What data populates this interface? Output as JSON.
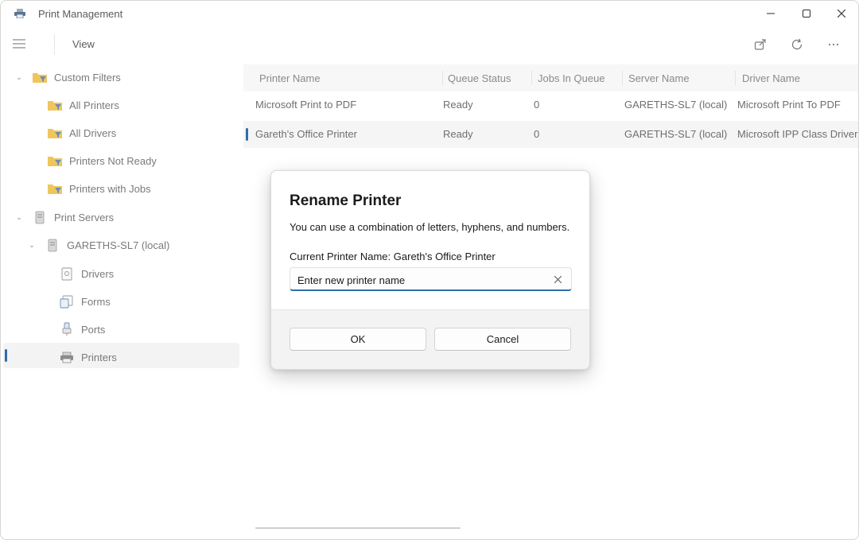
{
  "window": {
    "title": "Print Management",
    "controls": {
      "minimize": "—",
      "maximize": "☐",
      "close": "✕"
    }
  },
  "toolbar": {
    "menu_icon": "hamburger-icon",
    "view_label": "View",
    "icons": [
      "export-icon",
      "refresh-icon",
      "more-icon"
    ]
  },
  "nav": {
    "items": [
      {
        "label": "Custom Filters",
        "icon": "filter-folder-icon",
        "expanded": true
      },
      {
        "label": "All Printers",
        "icon": "filter-folder-icon"
      },
      {
        "label": "All Drivers",
        "icon": "filter-folder-icon"
      },
      {
        "label": "Printers Not Ready",
        "icon": "filter-folder-icon"
      },
      {
        "label": "Printers with Jobs",
        "icon": "filter-folder-icon"
      },
      {
        "label": "Print Servers",
        "icon": "server-icon",
        "expanded": true
      },
      {
        "label": "GARETHS-SL7 (local)",
        "icon": "server-icon",
        "expanded": true
      },
      {
        "label": "Drivers",
        "icon": "driver-icon"
      },
      {
        "label": "Forms",
        "icon": "forms-icon"
      },
      {
        "label": "Ports",
        "icon": "port-icon"
      },
      {
        "label": "Printers",
        "icon": "printer-icon",
        "selected": true
      }
    ]
  },
  "table": {
    "columns": [
      "Printer Name",
      "Queue Status",
      "Jobs In Queue",
      "Server Name",
      "Driver Name"
    ],
    "rows": [
      [
        "Microsoft Print to PDF",
        "Ready",
        "0",
        "GARETHS-SL7 (local)",
        "Microsoft Print To PDF"
      ],
      [
        "Gareth's Office Printer",
        "Ready",
        "0",
        "GARETHS-SL7 (local)",
        "Microsoft IPP Class Driver"
      ]
    ],
    "selected_row": 1
  },
  "dialog": {
    "title": "Rename Printer",
    "description": "You can use a combination of letters, hyphens, and numbers.",
    "current_label": "Current Printer Name:",
    "current_value": "Gareth's Office Printer",
    "input_placeholder": "Enter new printer name",
    "input_value": "",
    "ok_label": "OK",
    "cancel_label": "Cancel"
  },
  "colors": {
    "accent": "#2f6ea8",
    "folder": "#e8b84a"
  }
}
